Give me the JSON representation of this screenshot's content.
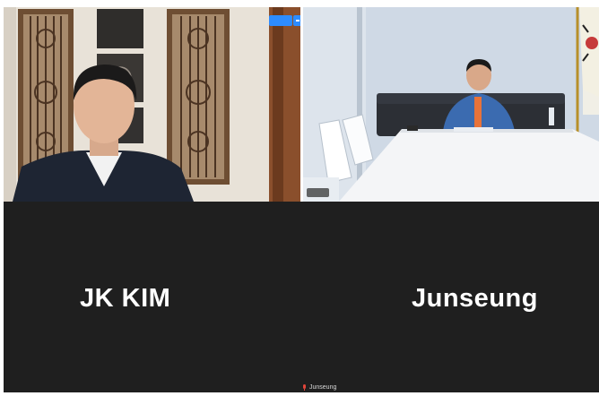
{
  "meeting": {
    "view_button_label": "",
    "participants": [
      {
        "name": "JK KIM"
      },
      {
        "name": "Junseung"
      }
    ],
    "active_speaker": "Junseung"
  },
  "colors": {
    "active_speaker_border": "#3fd26a",
    "tile_background": "#1f1f1f",
    "button_blue": "#2d8cff",
    "muted_mic": "#e0453a"
  }
}
